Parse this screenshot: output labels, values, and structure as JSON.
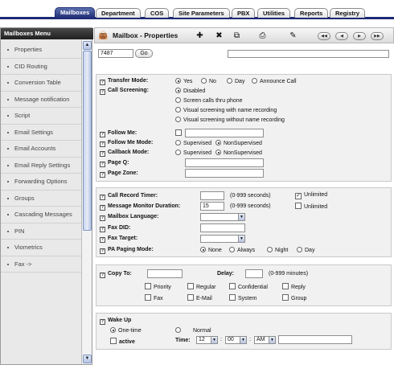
{
  "tabs": [
    "Mailboxes",
    "Department",
    "COS",
    "Site Parameters",
    "PBX",
    "Utilities",
    "Reports",
    "Registry"
  ],
  "sidebar": {
    "title": "Mailboxes Menu",
    "items": [
      "Properties",
      "CID Routing",
      "Conversion Table",
      "Message notification",
      "Script",
      "Email Settings",
      "Email Accounts",
      "Email Reply Settings",
      "Forwarding Options",
      "Groups",
      "Cascading Messages",
      "PIN",
      "Viometrics",
      "Fax ->"
    ]
  },
  "header": {
    "title": "Mailbox - Properties"
  },
  "search": {
    "mailbox_value": "7487",
    "go_label": "Go"
  },
  "transfer": {
    "transfer_mode_label": "Transfer Mode:",
    "transfer_options": [
      "Yes",
      "No",
      "Day",
      "Announce Call"
    ],
    "call_screening_label": "Call Screening:",
    "screening_options": [
      "Disabled",
      "Screen calls thru phone",
      "Visual screening with name recording",
      "Visual screening without name recording"
    ],
    "follow_me_label": "Follow Me:",
    "follow_me_mode_label": "Follow Me Mode:",
    "callback_mode_label": "Callback Mode:",
    "mode_options": [
      "Supervised",
      "NonSupervised"
    ],
    "page_q_label": "Page Q:",
    "page_zone_label": "Page Zone:"
  },
  "recording": {
    "call_record_timer_label": "Call Record Timer:",
    "seconds_hint": "(0-999 seconds)",
    "unlimited_label": "Unlimited",
    "message_monitor_label": "Message Monitor Duration:",
    "message_monitor_value": "15",
    "mailbox_language_label": "Mailbox Language:",
    "fax_did_label": "Fax DID:",
    "fax_target_label": "Fax Target:",
    "pa_paging_label": "PA Paging Mode:",
    "pa_options": [
      "None",
      "Always",
      "Night",
      "Day"
    ]
  },
  "copy": {
    "copy_to_label": "Copy To:",
    "delay_label": "Delay:",
    "minutes_hint": "(0-999 minutes)",
    "options_row1": [
      "Priority",
      "Regular",
      "Confidential",
      "Reply"
    ],
    "options_row2": [
      "Fax",
      "E-Mail",
      "System",
      "Group"
    ]
  },
  "wakeup": {
    "title": "Wake Up",
    "one_time": "One-time",
    "normal": "Normal",
    "active": "active",
    "time_label": "Time:",
    "hour": "12",
    "minute": "00",
    "ampm": "AM"
  }
}
